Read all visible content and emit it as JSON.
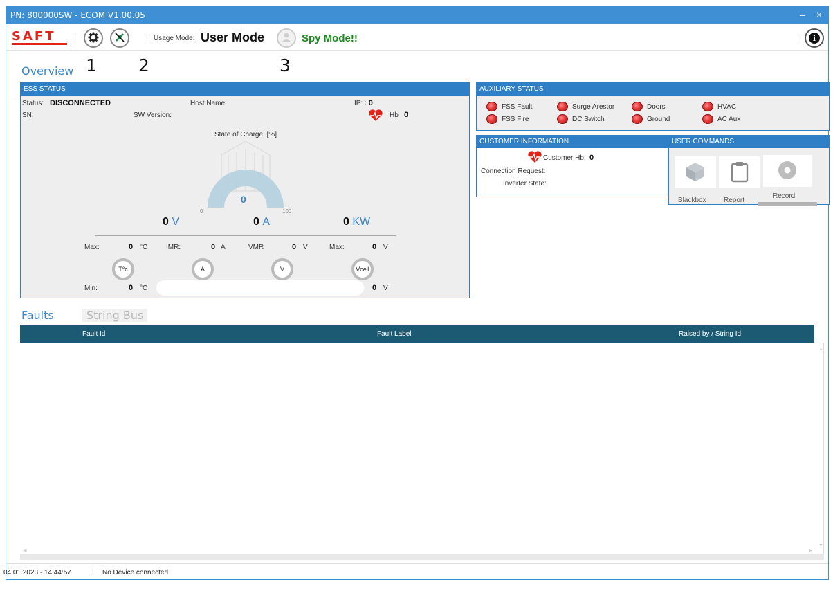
{
  "window": {
    "title": "PN: 800000SW - ECOM V1.00.05",
    "min_glyph": "–",
    "close_glyph": "×"
  },
  "toolbar": {
    "logo_text": "SAFT",
    "usage_mode_label": "Usage Mode:",
    "usage_mode_value": "User Mode",
    "spy_mode": "Spy Mode!!",
    "info_glyph": "i"
  },
  "annotations": [
    "1",
    "2",
    "3"
  ],
  "tabs": {
    "overview": "Overview",
    "faults": "Faults",
    "string_bus": "String Bus"
  },
  "ess": {
    "header": "ESS STATUS",
    "status_label": "Status:",
    "status_value": "DISCONNECTED",
    "host_label": "Host Name:",
    "ip_label": "IP:",
    "ip_value": ": 0",
    "sn_label": "SN:",
    "sw_label": "SW Version:",
    "hb_label": "Hb",
    "hb_value": "0",
    "soc_label": "State of Charge: [%]",
    "soc_value": "0",
    "soc_min": "0",
    "soc_max": "100",
    "voltage_value": "0",
    "voltage_unit": "V",
    "current_value": "0",
    "current_unit": "A",
    "power_value": "0",
    "power_unit": "KW",
    "max_label": "Max:",
    "temp_max": "0",
    "temp_unit": "°C",
    "imr_label": "IMR:",
    "imr_value": "0",
    "imr_unit": "A",
    "vmr_label": "VMR",
    "vmr_value": "0",
    "vmr_unit": "V",
    "vmax_label": "Max:",
    "vcell_max": "0",
    "vcell_unit": "V",
    "btn_temp": "T°c",
    "btn_a": "A",
    "btn_v": "V",
    "btn_vcell": "Vcell",
    "min_label": "Min:",
    "temp_min": "0",
    "vcell_min": "0"
  },
  "aux": {
    "header": "AUXILIARY STATUS",
    "items": [
      "FSS Fault",
      "Surge Arestor",
      "Doors",
      "HVAC",
      "FSS Fire",
      "DC Switch",
      "Ground",
      "AC Aux"
    ]
  },
  "customer": {
    "header": "CUSTOMER INFORMATION",
    "hb_label": "Customer Hb:",
    "hb_value": "0",
    "conn_label": "Connection Request:",
    "inv_label": "Inverter State:"
  },
  "commands": {
    "header": "USER COMMANDS",
    "blackbox": "Blackbox",
    "report": "Report",
    "record": "Record"
  },
  "faults_table": {
    "columns": [
      "Fault Id",
      "Fault Label",
      "Raised by / String Id"
    ]
  },
  "statusbar": {
    "datetime": "04.01.2023 - 14:44:57",
    "device": "No Device connected"
  },
  "colors": {
    "title_bar": "#3f8fd4",
    "panel_header": "#2f7fc7",
    "table_header": "#1b5a72",
    "spy_mode": "#1d8a1d",
    "led": "#e23a3a"
  }
}
